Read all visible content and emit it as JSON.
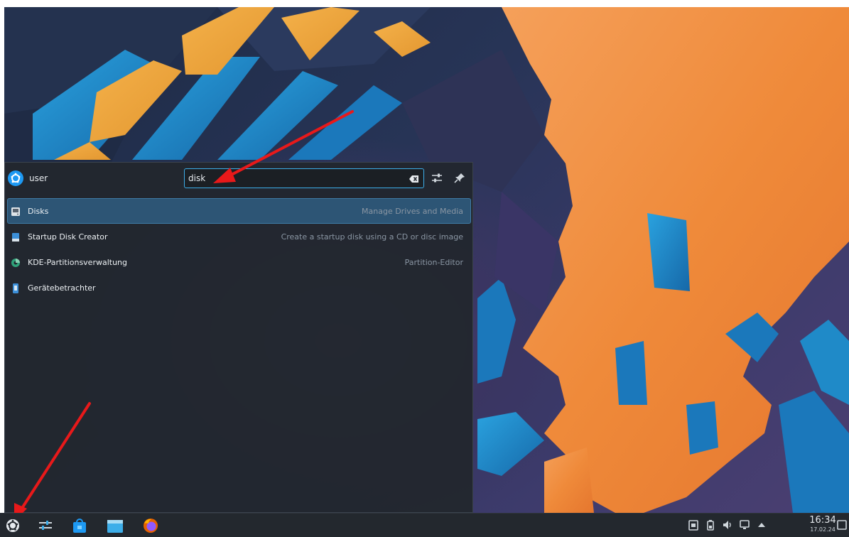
{
  "launcher": {
    "user_name": "user",
    "search": {
      "value": "disk",
      "placeholder": ""
    },
    "results": [
      {
        "name": "Disks",
        "description": "Manage Drives and Media",
        "icon": "disks-icon",
        "selected": true
      },
      {
        "name": "Startup Disk Creator",
        "description": "Create a startup disk using a CD or disc image",
        "icon": "usb-drive-icon",
        "selected": false
      },
      {
        "name": "KDE-Partitionsverwaltung",
        "description": "Partition-Editor",
        "icon": "partition-manager-icon",
        "selected": false
      },
      {
        "name": "Gerätebetrachter",
        "description": "",
        "icon": "device-viewer-icon",
        "selected": false
      }
    ]
  },
  "taskbar": {
    "apps": [
      "application-launcher-icon",
      "system-settings-icon",
      "discover-store-icon",
      "file-manager-icon",
      "firefox-icon"
    ],
    "tray": [
      "clipboard-icon",
      "battery-icon",
      "volume-icon",
      "network-icon",
      "tray-expand-icon"
    ],
    "clock": {
      "time": "16:34",
      "date": "17.02.24"
    }
  },
  "colors": {
    "accent": "#3daee9",
    "panel_bg": "#22272e",
    "selection": "#2d5575",
    "arrow": "#e8191a",
    "wallpaper_orange": "#f08e3c",
    "wallpaper_blue": "#1f8ac8"
  }
}
